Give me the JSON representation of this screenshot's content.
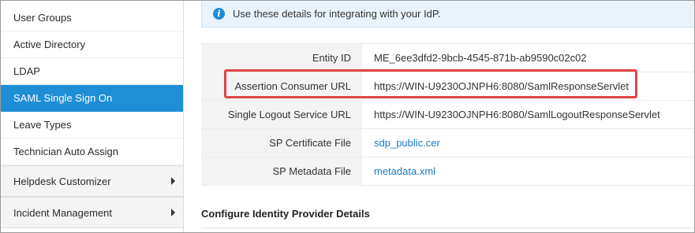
{
  "sidebar": {
    "items": [
      {
        "label": "User Groups"
      },
      {
        "label": "Active Directory"
      },
      {
        "label": "LDAP"
      },
      {
        "label": "SAML Single Sign On",
        "active": true
      },
      {
        "label": "Leave Types"
      },
      {
        "label": "Technician Auto Assign"
      }
    ],
    "groups": [
      {
        "label": "Helpdesk Customizer",
        "icon": "chevron-right-icon"
      },
      {
        "label": "Incident Management",
        "icon": "chevron-right-icon"
      }
    ]
  },
  "info_banner": {
    "icon": "info-icon",
    "text": "Use these details for integrating with your IdP."
  },
  "details": [
    {
      "label": "Entity ID",
      "value": "ME_6ee3dfd2-9bcb-4545-871b-ab9590c02c02"
    },
    {
      "label": "Assertion Consumer URL",
      "value": "https://WIN-U9230OJNPH6:8080/SamlResponseServlet",
      "highlighted": true
    },
    {
      "label": "Single Logout Service URL",
      "value": "https://WIN-U9230OJNPH6:8080/SamlLogoutResponseServlet"
    },
    {
      "label": "SP Certificate File",
      "value": "sdp_public.cer",
      "link": true
    },
    {
      "label": "SP Metadata File",
      "value": "metadata.xml",
      "link": true
    }
  ],
  "section": {
    "title": "Configure Identity Provider Details"
  },
  "colors": {
    "active_item": "#1e8ed6",
    "link": "#1a7ac4",
    "highlight_border": "#e04444",
    "info_bg": "#e9f3fb"
  }
}
